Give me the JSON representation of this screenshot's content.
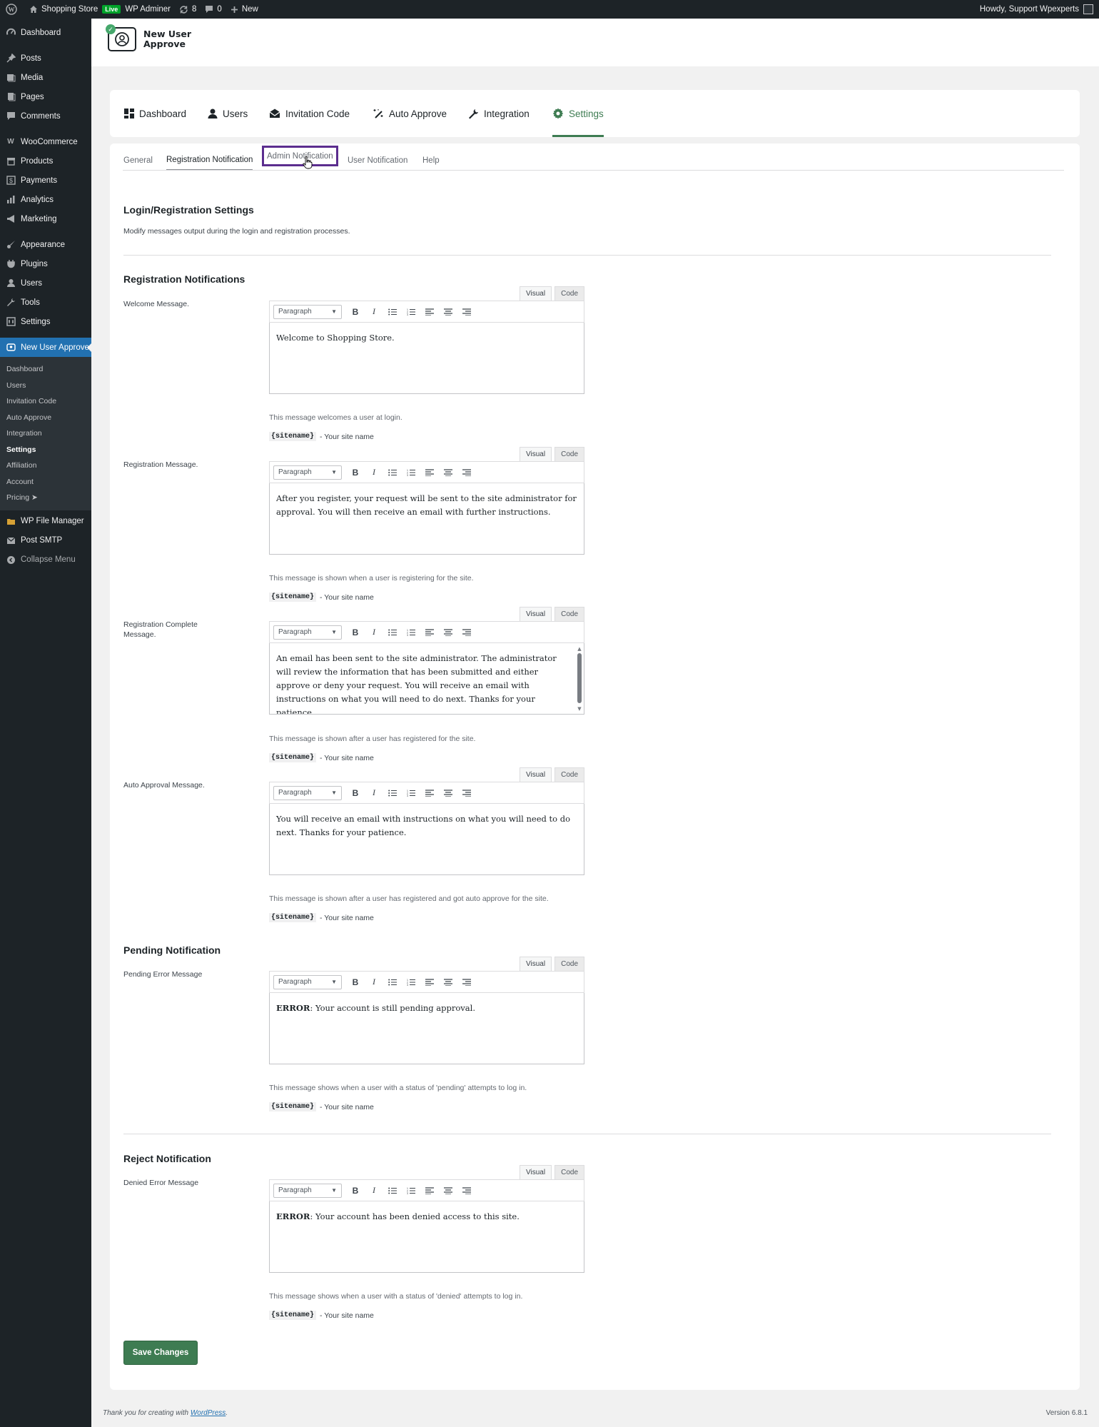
{
  "adminbar": {
    "site_name": "Shopping Store",
    "live_badge": "Live",
    "wp_adminer": "WP Adminer",
    "updates_count": "8",
    "comments_count": "0",
    "new_label": "New",
    "howdy": "Howdy, Support Wpexperts"
  },
  "sidebar": {
    "items": [
      {
        "label": "Dashboard",
        "icon": "dashboard-icon"
      },
      {
        "label": "Posts",
        "icon": "pin-icon"
      },
      {
        "label": "Media",
        "icon": "media-icon"
      },
      {
        "label": "Pages",
        "icon": "page-icon"
      },
      {
        "label": "Comments",
        "icon": "comment-icon"
      },
      {
        "label": "WooCommerce",
        "icon": "woo-icon"
      },
      {
        "label": "Products",
        "icon": "archive-icon"
      },
      {
        "label": "Payments",
        "icon": "dollar-icon"
      },
      {
        "label": "Analytics",
        "icon": "chart-icon"
      },
      {
        "label": "Marketing",
        "icon": "megaphone-icon"
      },
      {
        "label": "Appearance",
        "icon": "brush-icon"
      },
      {
        "label": "Plugins",
        "icon": "plug-icon"
      },
      {
        "label": "Users",
        "icon": "user-icon"
      },
      {
        "label": "Tools",
        "icon": "wrench-icon"
      },
      {
        "label": "Settings",
        "icon": "settings-icon"
      },
      {
        "label": "New User Approve",
        "icon": "nua-icon"
      }
    ],
    "submenu": [
      "Dashboard",
      "Users",
      "Invitation Code",
      "Auto Approve",
      "Integration",
      "Settings",
      "Affiliation",
      "Account",
      "Pricing ➤"
    ],
    "after": [
      {
        "label": "WP File Manager",
        "icon": "folder-icon"
      },
      {
        "label": "Post SMTP",
        "icon": "mail-icon"
      },
      {
        "label": "Collapse Menu",
        "icon": "collapse-icon"
      }
    ]
  },
  "plugin": {
    "logo_text": "New User Approve"
  },
  "main_tabs": [
    "Dashboard",
    "Users",
    "Invitation Code",
    "Auto Approve",
    "Integration",
    "Settings"
  ],
  "sub_tabs": [
    "General",
    "Registration Notification",
    "Admin Notification",
    "User Notification",
    "Help"
  ],
  "login_section": {
    "title": "Login/Registration Settings",
    "desc": "Modify messages output during the login and registration processes."
  },
  "editor_common": {
    "visual": "Visual",
    "code": "Code",
    "format": "Paragraph",
    "tag": "{sitename}",
    "tag_desc": "- Your site name"
  },
  "registration": {
    "title": "Registration Notifications",
    "welcome": {
      "label": "Welcome Message.",
      "content": "Welcome to Shopping Store.",
      "help": "This message welcomes a user at login."
    },
    "registration": {
      "label": "Registration Message.",
      "content": "After you register, your request will be sent to the site administrator for approval. You will then receive an email with further instructions.",
      "help": "This message is shown when a user is registering for the site."
    },
    "complete": {
      "label": "Registration Complete Message.",
      "content": "An email has been sent to the site administrator. The administrator will review the information that has been submitted and either approve or deny your request. You will receive an email with instructions on what you will need to do next. Thanks for your patience.",
      "help": "This message is shown after a user has registered for the site."
    },
    "auto": {
      "label": "Auto Approval Message.",
      "content": "You will receive an email with instructions on what you will need to do next. Thanks for your patience.",
      "help": "This message is shown after a user has registered and got auto approve for the site."
    }
  },
  "pending": {
    "title": "Pending Notification",
    "label": "Pending Error Message",
    "prefix": "ERROR",
    "content": ": Your account is still pending approval.",
    "help": "This message shows when a user with a status of 'pending' attempts to log in."
  },
  "reject": {
    "title": "Reject Notification",
    "label": "Denied Error Message",
    "prefix": "ERROR",
    "content": ": Your account has been denied access to this site.",
    "help": "This message shows when a user with a status of 'denied' attempts to log in."
  },
  "save_label": "Save Changes",
  "footer": {
    "thanks": "Thank you for creating with",
    "link": "WordPress",
    "version": "Version 6.8.1"
  },
  "colors": {
    "accent": "#3e7c52",
    "admin_dark": "#1d2327",
    "wp_blue": "#2271b1",
    "focus_outline": "#5b2d8e"
  }
}
